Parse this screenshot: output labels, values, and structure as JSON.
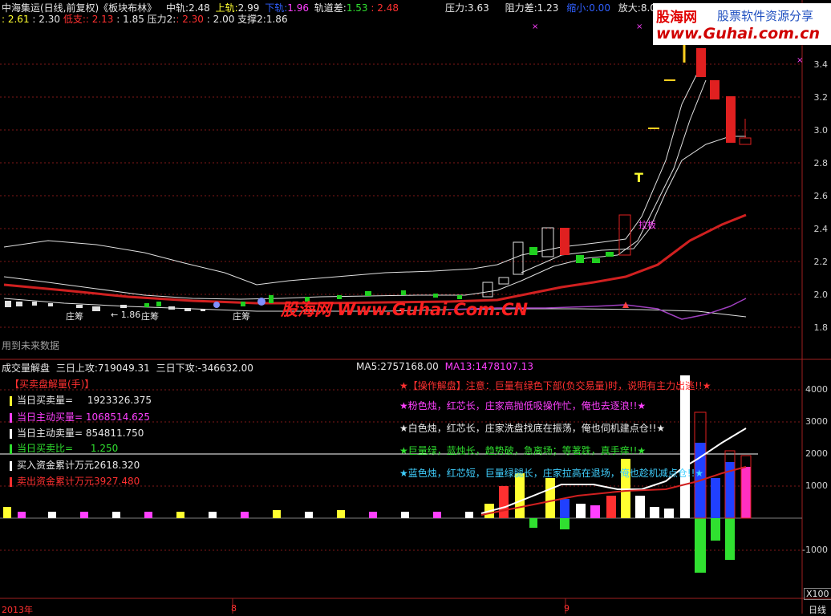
{
  "top_info": {
    "title": "中海集运(日线,前复权)《板块布林》",
    "mid_label": "中轨:",
    "mid_val": "2.48",
    "up_label": "上轨:",
    "up_val": "2.99",
    "down_label": "下轨:",
    "down_val": "1.96",
    "diff_label": "轨道差:",
    "diff_val": "1.53",
    "diff_val2": ": 2.48",
    "pressure_label": "压力:",
    "pressure_val": "3.63",
    "resist_label": "阻力差:",
    "resist_val": "1.23",
    "shrink_label": "缩小:",
    "shrink_val": "0.00",
    "enlarge_label": "放大:",
    "enlarge_val": "8.00"
  },
  "second_line": {
    "a": ": 2.61",
    "b": ": 2.30",
    "low_label": "低支:",
    "low_val": ": 2.13",
    "c": ": 1.85",
    "p2_label": "压力2:",
    "p2_val": ": 2.30",
    "d": ": 2.00",
    "s2_label": "支撑2:",
    "s2_val": "1.86"
  },
  "logo": {
    "name": "股海网",
    "slogan": "股票软件资源分享",
    "url": "www.Guhai.com.cn"
  },
  "watermark": "股海网 Www.Guhai.Com.CN",
  "price_axis": [
    "3.4",
    "3.2",
    "3.0",
    "2.8",
    "2.6",
    "2.4",
    "2.2",
    "2.0",
    "1.8"
  ],
  "price_annotations": {
    "zhuangchou": "庄筹",
    "low_price": "← 1.86",
    "laban": "拉板",
    "t_mark": "T"
  },
  "future_data_label": "用到未来数据",
  "vol_header": {
    "title": "成交量解盘",
    "up3_label": "三日上攻:",
    "up3_val": "719049.31",
    "down3_label": "三日下攻:",
    "down3_val": "-346632.00",
    "ma5_label": "MA5:",
    "ma5_val": "2757168.00",
    "ma13_label": "MA13:",
    "ma13_val": "1478107.13"
  },
  "panel": {
    "title": "【买卖盘解量(手)】",
    "items": [
      {
        "label": "当日买卖量=",
        "value": "1923326.375",
        "color": "#ffffff"
      },
      {
        "label": "当日主动买量=",
        "value": "1068514.625",
        "color": "#ff40ff"
      },
      {
        "label": "当日主动卖量=",
        "value": "854811.750",
        "color": "#ffffff"
      },
      {
        "label": "当日买卖比=",
        "value": "1.250",
        "color": "#30e030"
      },
      {
        "label": "买入资金累计万元",
        "value": "2618.320",
        "color": "#ffffff"
      },
      {
        "label": "卖出资金累计万元",
        "value": "3927.480",
        "color": "#ff3030"
      }
    ]
  },
  "notes": [
    {
      "text": "★【操作解盘】注意：巨量有绿色下部(负交易量)时，说明有主力出逃!!★",
      "color": "#ff3030"
    },
    {
      "text": "★粉色烛，红芯长，庄家高抛低吸操作忙，俺也去逐浪!!★",
      "color": "#ff40ff"
    },
    {
      "text": "★白色烛，红芯长，庄家洗盘找底在振荡，俺也伺机建点仓!!★",
      "color": "#ffffff"
    },
    {
      "text": "★巨量绿，蓝烛长，趋势破，急离场；等著跌，真手痒!!★",
      "color": "#30e030"
    },
    {
      "text": "★蓝色烛，红芯短，巨量绿腿长，庄家拉高在退场，俺也趁机减点仓!!★",
      "color": "#40d0ff"
    }
  ],
  "vol_axis": [
    "4000",
    "3000",
    "2000",
    "1000",
    "-1000"
  ],
  "vol_unit": "X100",
  "time_axis": [
    "2013年",
    "8",
    "9"
  ],
  "period_label": "日线"
}
